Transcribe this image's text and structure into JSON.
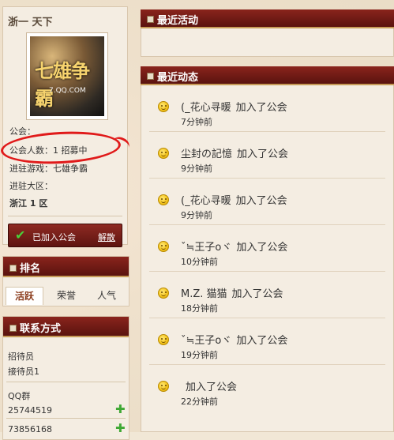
{
  "guild": {
    "name": "浙一 天下",
    "logo_text": "七雄争霸",
    "logo_subtext": "7.QQ.COM",
    "info_line1": "公会：",
    "member_count": "公会人数：1   招募中",
    "game": "进驻游戏：七雄争霸",
    "zone_label": "进驻大区：",
    "zone": "浙江 1 区",
    "joined_label": "已加入公会",
    "dismiss_label": "解散"
  },
  "ranking": {
    "title": "排名",
    "tabs": [
      "活跃",
      "荣誉",
      "人气"
    ]
  },
  "contact": {
    "title": "联系方式",
    "recruiter": "招待员",
    "recruiter1": "接待员1",
    "qq_group_label": "QQ群",
    "qq_groups": [
      "25744519",
      "73856168"
    ]
  },
  "recent_activity": {
    "title": "最近活动"
  },
  "recent_updates": {
    "title": "最近动态",
    "items": [
      {
        "user": "(_花心寻暖",
        "action": "加入了公会",
        "time": "7分钟前"
      },
      {
        "user": "尘封の記憶",
        "action": "加入了公会",
        "time": "9分钟前"
      },
      {
        "user": "(_花心寻暖",
        "action": "加入了公会",
        "time": "9分钟前"
      },
      {
        "user": "ˇ≒王子oヾ",
        "action": "加入了公会",
        "time": "10分钟前"
      },
      {
        "user": "M.Z.  猫猫",
        "action": "加入了公会",
        "time": "18分钟前"
      },
      {
        "user": "ˇ≒王子oヾ",
        "action": "加入了公会",
        "time": "19分钟前"
      },
      {
        "user": "",
        "action": "加入了公会",
        "time": "22分钟前"
      }
    ]
  }
}
